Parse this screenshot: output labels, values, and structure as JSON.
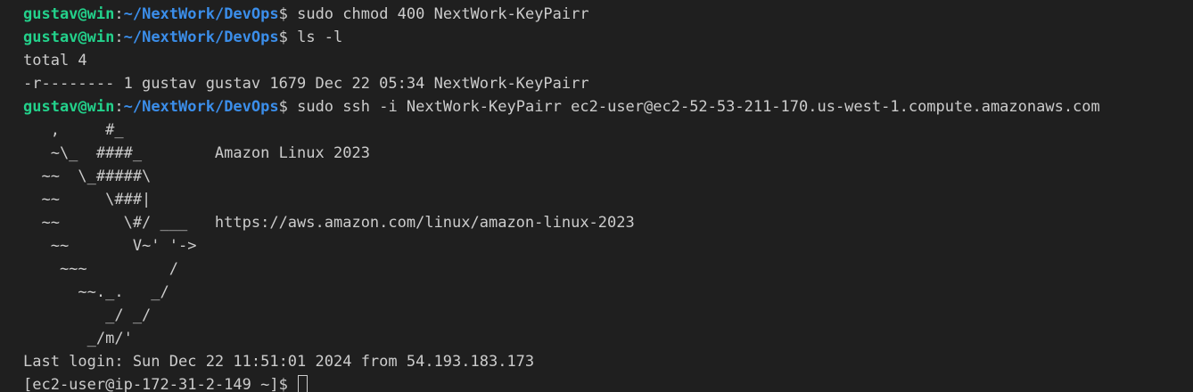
{
  "prompt_user": "gustav@win",
  "prompt_path": "~/NextWork/DevOps",
  "commands": [
    "sudo chmod 400 NextWork-KeyPairr",
    "ls -l",
    "sudo ssh -i NextWork-KeyPairr ec2-user@ec2-52-53-211-170.us-west-1.compute.amazonaws.com"
  ],
  "output": {
    "total": "total 4",
    "file_listing": "-r-------- 1 gustav gustav 1679 Dec 22 05:34 NextWork-KeyPairr"
  },
  "banner": [
    "   ,     #_",
    "   ~\\_  ####_        Amazon Linux 2023",
    "  ~~  \\_#####\\",
    "  ~~     \\###|",
    "  ~~       \\#/ ___   https://aws.amazon.com/linux/amazon-linux-2023",
    "   ~~       V~' '->",
    "    ~~~         /",
    "      ~~._.   _/",
    "         _/ _/",
    "       _/m/'"
  ],
  "last_login": "Last login: Sun Dec 22 11:51:01 2024 from 54.193.183.173",
  "remote_prompt": "[ec2-user@ip-172-31-2-149 ~]$ "
}
